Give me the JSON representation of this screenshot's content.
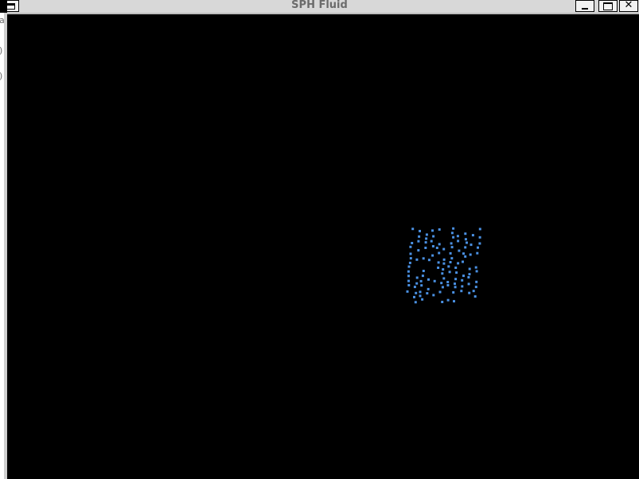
{
  "window": {
    "title": "SPH Fluid"
  },
  "titlebar": {
    "close_glyph": "✕"
  },
  "desktop": {
    "strip_glyphs": [
      "a",
      ")",
      ")"
    ]
  },
  "simulation": {
    "background": "#000000",
    "particle_color": "#4a90e2"
  }
}
